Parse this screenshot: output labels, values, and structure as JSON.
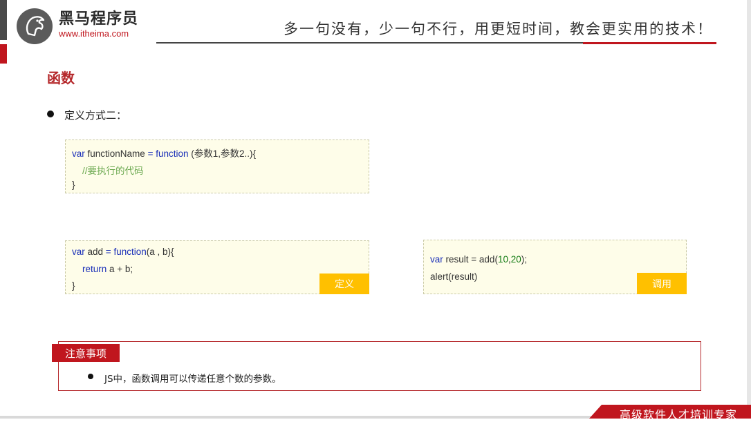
{
  "header": {
    "logo_name": "黑马程序员",
    "logo_url": "www.itheima.com",
    "slogan": "多一句没有，少一句不行，用更短时间，教会更实用的技术！"
  },
  "page_title": "函数",
  "section": {
    "bullet": "定义方式二："
  },
  "code_syntax": {
    "line1": {
      "kw1": "var",
      "name": " functionName ",
      "eq": "=",
      "kw2": " function",
      "args": " (参数1,参数2..){"
    },
    "line2": "//要执行的代码",
    "line3": "}"
  },
  "code_define": {
    "line1": {
      "kw1": "var",
      "name": " add ",
      "eq": "=",
      "kw2": " function",
      "args": "(a , b){"
    },
    "line2": {
      "kw": "return",
      "expr": " a + b;"
    },
    "line3": "}",
    "tag": "定义"
  },
  "code_call": {
    "line1": {
      "kw": "var",
      "name": " result = add(",
      "n1": "10",
      "sep": ",",
      "n2": "20",
      "end": ");"
    },
    "line2": "alert(result)",
    "tag": "调用"
  },
  "note": {
    "label": "注意事项",
    "text": "JS中，函数调用可以传递任意个数的参数。"
  },
  "footer": {
    "text": "高级软件人才培训专家"
  },
  "colors": {
    "brand_red": "#c0161e",
    "tag_yellow": "#ffc000",
    "code_bg": "#fefde9",
    "keyword_blue": "#1a2fb8"
  },
  "icons": {
    "logo": "horse-head-logo-icon"
  }
}
